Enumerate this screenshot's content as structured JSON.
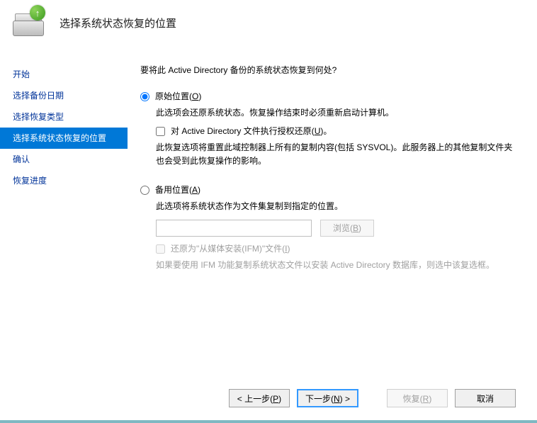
{
  "header": {
    "title": "选择系统状态恢复的位置"
  },
  "sidebar": {
    "steps": [
      "开始",
      "选择备份日期",
      "选择恢复类型",
      "选择系统状态恢复的位置",
      "确认",
      "恢复进度"
    ],
    "current_index": 3
  },
  "main": {
    "prompt": "要将此 Active Directory 备份的系统状态恢复到何处?",
    "option1": {
      "label_pre": "原始位置(",
      "key": "O",
      "label_post": ")",
      "desc": "此选项会还原系统状态。恢复操作结束时必须重新启动计算机。",
      "sub_checkbox_pre": "对 Active Directory 文件执行授权还原(",
      "sub_checkbox_key": "U",
      "sub_checkbox_post": ")。",
      "sub_desc": "此恢复选项将重置此域控制器上所有的复制内容(包括 SYSVOL)。此服务器上的其他复制文件夹也会受到此恢复操作的影响。"
    },
    "option2": {
      "label_pre": "备用位置(",
      "key": "A",
      "label_post": ")",
      "desc": "此选项将系统状态作为文件集复制到指定的位置。",
      "path_value": "",
      "browse_pre": "浏览(",
      "browse_key": "B",
      "browse_post": ")",
      "ifm_checkbox_pre": "还原为\"从媒体安装(IFM)\"文件(",
      "ifm_checkbox_key": "I",
      "ifm_checkbox_post": ")",
      "ifm_desc": "如果要使用 IFM 功能复制系统状态文件以安装 Active Directory 数据库，则选中该复选框。"
    }
  },
  "footer": {
    "prev_pre": "< 上一步(",
    "prev_key": "P",
    "prev_post": ")",
    "next_pre": "下一步(",
    "next_key": "N",
    "next_post": ") >",
    "recover_pre": "恢复(",
    "recover_key": "R",
    "recover_post": ")",
    "cancel": "取消"
  }
}
